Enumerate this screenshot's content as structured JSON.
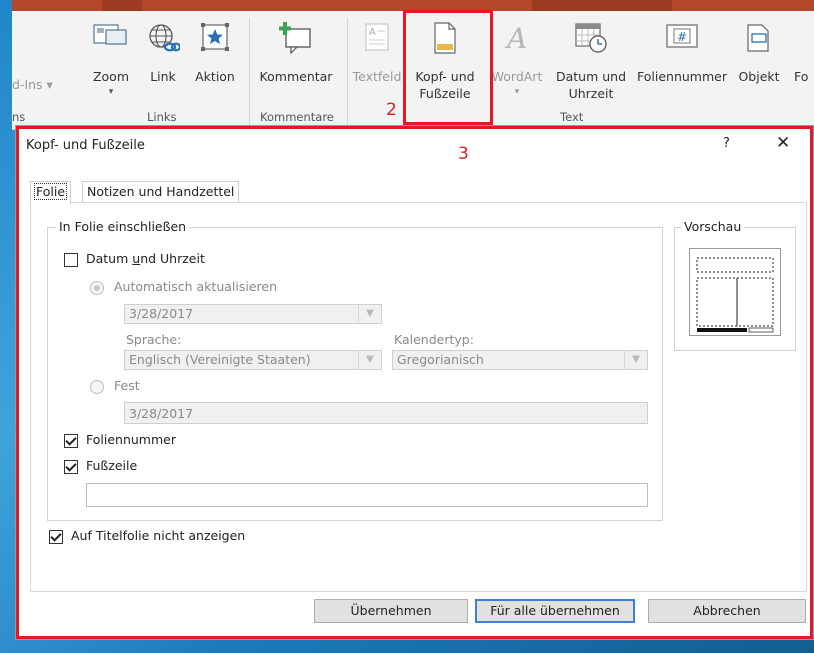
{
  "ribbon": {
    "addins_label": "d-Ins",
    "buttons": {
      "zoom": "Zoom",
      "link": "Link",
      "action": "Aktion",
      "comment": "Kommentar",
      "textbox": "Textfeld",
      "header_footer": "Kopf- und Fußzeile",
      "header_footer_l1": "Kopf- und",
      "header_footer_l2": "Fußzeile",
      "wordart": "WordArt",
      "date_time_l1": "Datum und",
      "date_time_l2": "Uhrzeit",
      "slide_number": "Foliennummer",
      "object": "Objekt",
      "edge": "Fo"
    },
    "groups": {
      "left": "ns",
      "links": "Links",
      "comments": "Kommentare",
      "text": "Text"
    }
  },
  "annotations": {
    "step2": "2",
    "step3": "3"
  },
  "dialog": {
    "title": "Kopf- und Fußzeile",
    "help": "?",
    "close": "✕",
    "tabs": {
      "slide": "Folie",
      "notes": "Notizen und Handzettel"
    },
    "include_legend": "In Folie einschließen",
    "date_time": {
      "checked": false,
      "label_pre": "Datum ",
      "label_u": "u",
      "label_post": "nd Uhrzeit"
    },
    "auto_update": {
      "label_pre": "Automatisch aktualisieren"
    },
    "date_value": "3/28/2017",
    "language_label": "Sprache:",
    "language_value": "Englisch (Vereinigte Staaten)",
    "calendar_label": "Kalendertyp:",
    "calendar_value": "Gregorianisch",
    "fixed_label": "Fest",
    "fixed_value": "3/28/2017",
    "slide_number": {
      "checked": true,
      "label": "Foliennummer"
    },
    "footer": {
      "checked": true,
      "label": "Fußzeile",
      "value": ""
    },
    "preview_legend": "Vorschau",
    "hide_title": {
      "checked": true,
      "label": "Auf Titelfolie nicht anzeigen"
    },
    "buttons": {
      "apply": "Übernehmen",
      "apply_all": "Für alle übernehmen",
      "cancel": "Abbrechen"
    }
  }
}
